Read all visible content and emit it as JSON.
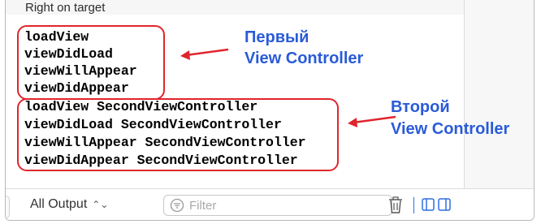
{
  "header": {
    "text": "Right on target"
  },
  "console": {
    "first_group": [
      "loadView",
      "viewDidLoad",
      "viewWillAppear",
      "viewDidAppear"
    ],
    "second_group": [
      "loadView SecondViewController",
      "viewDidLoad SecondViewController",
      "viewWillAppear SecondViewController",
      "viewDidAppear SecondViewController"
    ]
  },
  "annotations": {
    "first_line1": "Первый",
    "first_line2": "View Controller",
    "second_line1": "Второй",
    "second_line2": "View Controller"
  },
  "toolbar": {
    "output_label": "All Output",
    "filter_placeholder": "Filter"
  },
  "colors": {
    "highlight_box": "#e0252d",
    "annotation_text": "#2a5bd7",
    "accent": "#2f6fe0"
  }
}
